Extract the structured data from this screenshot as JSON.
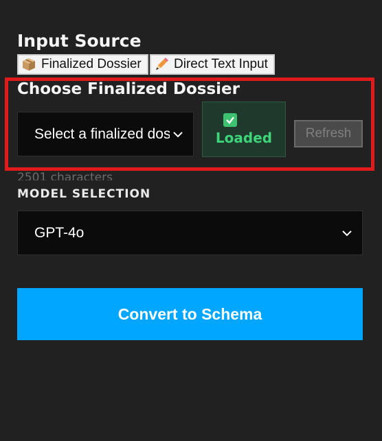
{
  "input_source": {
    "title": "Input Source",
    "tabs": [
      {
        "label": "Finalized Dossier",
        "icon": "package-icon"
      },
      {
        "label": "Direct Text Input",
        "icon": "pencil-icon"
      }
    ]
  },
  "dossier": {
    "title": "Choose Finalized Dossier",
    "select_value": "Select a finalized dossier",
    "status_label": "Loaded",
    "refresh_label": "Refresh"
  },
  "char_count": "2501 characters",
  "model": {
    "label": "MODEL SELECTION",
    "selected": "GPT-4o"
  },
  "convert_label": "Convert to Schema",
  "colors": {
    "background": "#212121",
    "accent": "#00a6ff",
    "highlight": "#e11b1b",
    "success": "#3dd47a"
  }
}
